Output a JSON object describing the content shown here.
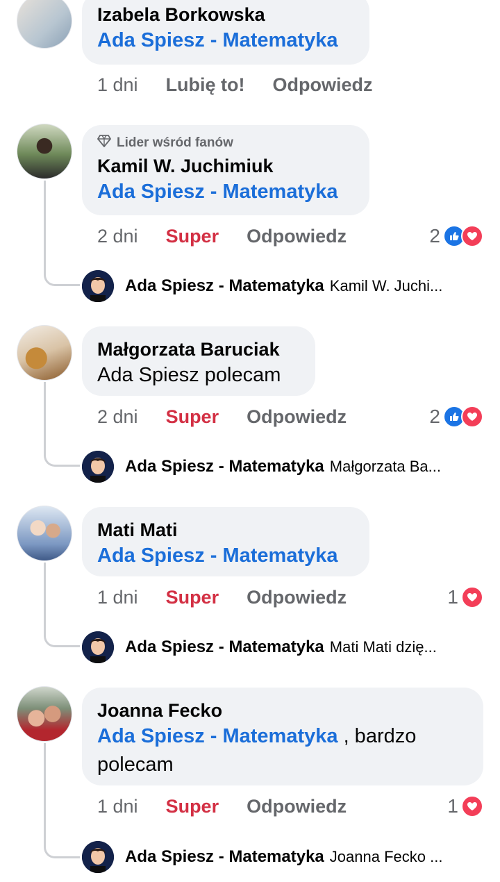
{
  "colors": {
    "mention": "#1b6ed9",
    "super": "#d33044",
    "muted": "#65676b",
    "bubble": "#f0f2f5"
  },
  "comments": [
    {
      "author": "Izabela Borkowska",
      "mention": "Ada Spiesz - Matematyka",
      "time": "1 dni",
      "reaction_label": "Lubię to!",
      "reply_label": "Odpowiedz"
    },
    {
      "badge": "Lider wśród fanów",
      "author": "Kamil W. Juchimiuk",
      "mention": "Ada Spiesz - Matematyka",
      "time": "2 dni",
      "reaction_label": "Super",
      "reply_label": "Odpowiedz",
      "reaction_count": "2",
      "reply_preview": {
        "name": "Ada Spiesz - Matematyka",
        "text": "Kamil W. Juchi..."
      }
    },
    {
      "author": "Małgorzata Baruciak",
      "text": "Ada Spiesz polecam",
      "time": "2 dni",
      "reaction_label": "Super",
      "reply_label": "Odpowiedz",
      "reaction_count": "2",
      "reply_preview": {
        "name": "Ada Spiesz - Matematyka",
        "text": "Małgorzata Ba..."
      }
    },
    {
      "author": "Mati Mati",
      "mention": "Ada Spiesz - Matematyka",
      "time": "1 dni",
      "reaction_label": "Super",
      "reply_label": "Odpowiedz",
      "reaction_count": "1",
      "reply_preview": {
        "name": "Ada Spiesz - Matematyka",
        "text": "Mati Mati dzię..."
      }
    },
    {
      "author": "Joanna Fecko",
      "mention": "Ada Spiesz - Matematyka",
      "text_after": " , bardzo",
      "text_line2": "polecam",
      "time": "1 dni",
      "reaction_label": "Super",
      "reply_label": "Odpowiedz",
      "reaction_count": "1",
      "reply_preview": {
        "name": "Ada Spiesz - Matematyka",
        "text": "Joanna Fecko ..."
      }
    }
  ]
}
